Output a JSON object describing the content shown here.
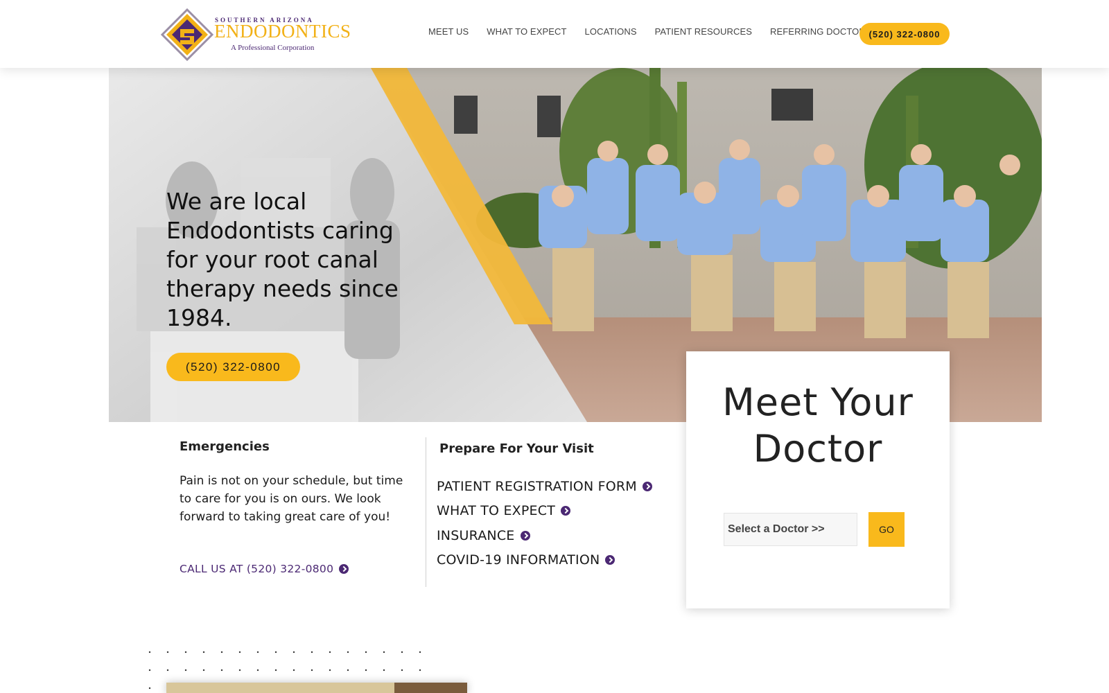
{
  "header": {
    "logo": {
      "top_line": "SOUTHERN ARIZONA",
      "main": "ENDODONTICS",
      "sub": "A Professional Corporation"
    },
    "nav": [
      "MEET US",
      "WHAT TO EXPECT",
      "LOCATIONS",
      "PATIENT RESOURCES",
      "REFERRING DOCTORS"
    ],
    "phone": "(520) 322-0800"
  },
  "hero": {
    "title": "We are local Endodontists caring for your root canal therapy needs since 1984.",
    "phone": "(520) 322-0800"
  },
  "emergencies": {
    "heading": "Emergencies",
    "body": "Pain is not on your schedule, but time to care for you is on ours. We look forward to taking great care of you!",
    "link": "CALL US AT (520) 322-0800"
  },
  "prepare": {
    "heading": "Prepare For Your Visit",
    "links": [
      "PATIENT REGISTRATION FORM",
      "WHAT TO EXPECT",
      "INSURANCE",
      "COVID-19 INFORMATION"
    ]
  },
  "doctor_card": {
    "title_line1": "Meet Your",
    "title_line2": "Doctor",
    "select_value": "Select a Doctor >>",
    "go_label": "GO"
  },
  "colors": {
    "accent_yellow": "#f9b91c",
    "brand_purple": "#4b2873"
  }
}
